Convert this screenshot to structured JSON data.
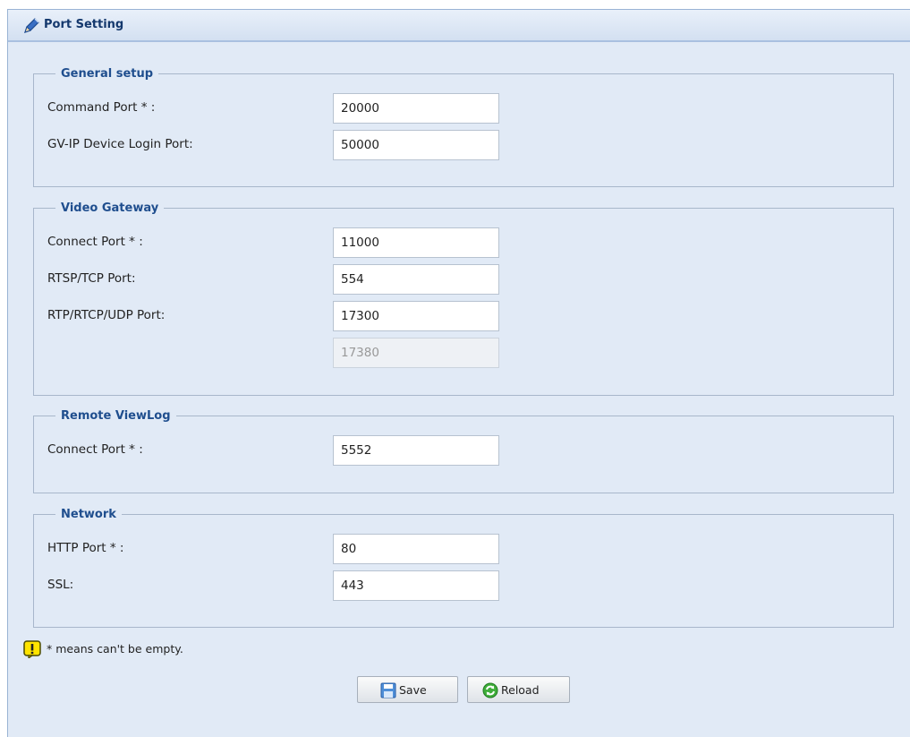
{
  "header": {
    "title": "Port Setting",
    "icon": "pencil-icon"
  },
  "sections": {
    "general": {
      "legend": "General setup",
      "command_port": {
        "label": "Command Port * :",
        "value": "20000"
      },
      "login_port": {
        "label": "GV-IP Device Login Port:",
        "value": "50000"
      }
    },
    "video": {
      "legend": "Video Gateway",
      "connect_port": {
        "label": "Connect Port * :",
        "value": "11000"
      },
      "rtsp_tcp_port": {
        "label": "RTSP/TCP Port:",
        "value": "554"
      },
      "rtp_udp_port": {
        "label": "RTP/RTCP/UDP Port:",
        "value": "17300",
        "end_value": "17380"
      }
    },
    "viewlog": {
      "legend": "Remote ViewLog",
      "connect_port": {
        "label": "Connect Port * :",
        "value": "5552"
      }
    },
    "network": {
      "legend": "Network",
      "http_port": {
        "label": "HTTP Port * :",
        "value": "80"
      },
      "ssl": {
        "label": "SSL:",
        "value": "443"
      }
    }
  },
  "note": {
    "text": "* means can't be empty.",
    "icon": "warning-icon"
  },
  "buttons": {
    "save": {
      "label": "Save",
      "icon": "floppy-disk-icon"
    },
    "reload": {
      "label": "Reload",
      "icon": "refresh-icon"
    }
  },
  "colors": {
    "panel_bg": "#e1eaf6",
    "title": "#14386d",
    "legend": "#1f4e8e"
  }
}
